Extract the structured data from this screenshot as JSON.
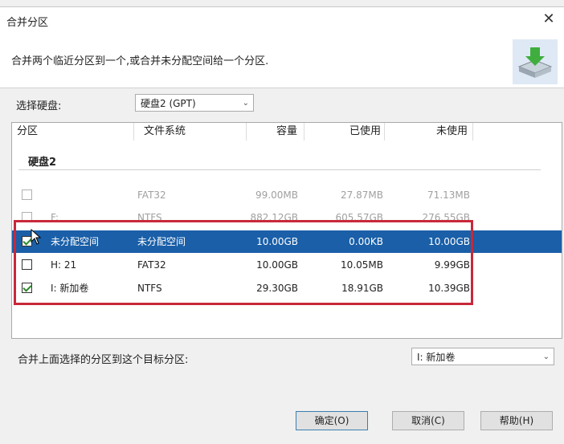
{
  "dialog": {
    "title": "合并分区",
    "description": "合并两个临近分区到一个,或合并未分配空间给一个分区."
  },
  "disk_select": {
    "label": "选择硬盘:",
    "value": "硬盘2 (GPT)"
  },
  "table": {
    "columns": [
      "分区",
      "文件系统",
      "容量",
      "已使用",
      "未使用"
    ],
    "group": "硬盘2",
    "rows": [
      {
        "name": "",
        "fs": "FAT32",
        "capacity": "99.00MB",
        "used": "27.87MB",
        "free": "71.13MB",
        "checked": false,
        "state": "faded"
      },
      {
        "name": "F:",
        "fs": "NTFS",
        "capacity": "882.12GB",
        "used": "605.57GB",
        "free": "276.55GB",
        "checked": false,
        "state": "faded"
      },
      {
        "name": "未分配空间",
        "fs": "未分配空间",
        "capacity": "10.00GB",
        "used": "0.00KB",
        "free": "10.00GB",
        "checked": true,
        "state": "selected"
      },
      {
        "name": "H: 21",
        "fs": "FAT32",
        "capacity": "10.00GB",
        "used": "10.05MB",
        "free": "9.99GB",
        "checked": false,
        "state": "normal"
      },
      {
        "name": "I: 新加卷",
        "fs": "NTFS",
        "capacity": "29.30GB",
        "used": "18.91GB",
        "free": "10.39GB",
        "checked": true,
        "state": "normal"
      }
    ]
  },
  "target": {
    "label": "合并上面选择的分区到这个目标分区:",
    "value": "I: 新加卷"
  },
  "buttons": {
    "ok": "确定(O)",
    "cancel": "取消(C)",
    "help": "帮助(H)"
  },
  "colors": {
    "selection": "#1a5fa8",
    "highlight_border": "#c8283a",
    "check": "#2a8a2a"
  }
}
